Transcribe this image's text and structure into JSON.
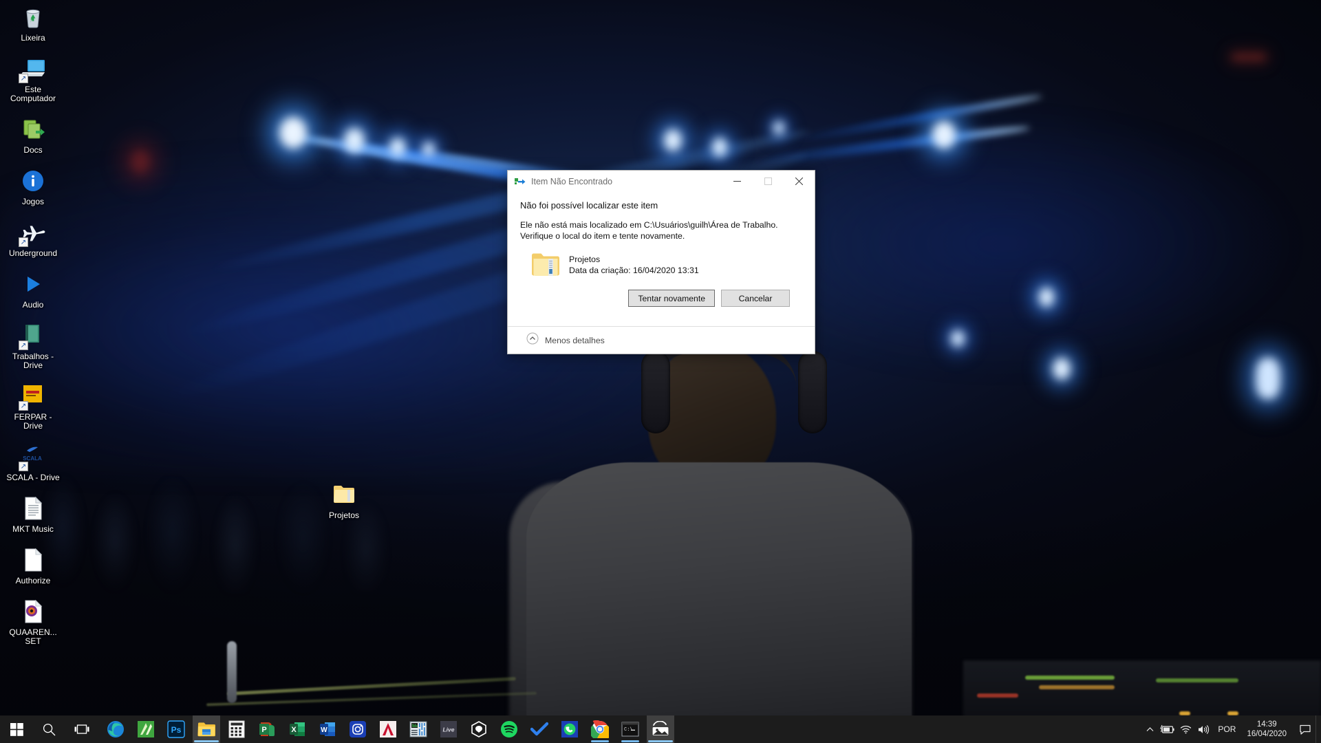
{
  "wallpaper": {
    "description": "dj-performing-at-concert-with-blue-laser-beams",
    "dominant_colors": [
      "#0a0f22",
      "#1a6fe0",
      "#2f9bff",
      "#3a3027"
    ]
  },
  "desktop": {
    "icons": [
      {
        "label": "Lixeira",
        "icon": "recycle-bin-icon",
        "shortcut": false
      },
      {
        "label": "Este Computador",
        "icon": "this-pc-icon",
        "shortcut": true
      },
      {
        "label": "Docs",
        "icon": "documents-folder-icon",
        "shortcut": false
      },
      {
        "label": "Jogos",
        "icon": "info-circle-icon",
        "shortcut": false
      },
      {
        "label": "Underground",
        "icon": "airplane-icon",
        "shortcut": true
      },
      {
        "label": "Audio",
        "icon": "play-triangle-icon",
        "shortcut": false
      },
      {
        "label": "Trabalhos - Drive",
        "icon": "green-book-icon",
        "shortcut": true
      },
      {
        "label": "FERPAR - Drive",
        "icon": "ferpar-yellow-icon",
        "shortcut": true
      },
      {
        "label": "SCALA - Drive",
        "icon": "scala-logo-icon",
        "shortcut": true
      },
      {
        "label": "MKT Music",
        "icon": "text-document-icon",
        "shortcut": false
      },
      {
        "label": "Authorize",
        "icon": "blank-document-icon",
        "shortcut": false
      },
      {
        "label": "QUAAREN... SET",
        "icon": "media-disc-document-icon",
        "shortcut": false
      }
    ],
    "free_item": {
      "label": "Projetos",
      "icon": "folder-icon"
    }
  },
  "dialog": {
    "title": "Item Não Encontrado",
    "title_icon": "move-item-icon",
    "window_controls": {
      "minimize": "minimize-icon",
      "maximize": "maximize-icon",
      "close": "close-icon"
    },
    "main_message": "Não foi possível localizar este item",
    "sub_message_line1": "Ele não está mais localizado em C:\\Usuários\\guilh\\Área de Trabalho.",
    "sub_message_line2": "Verifique o local do item e tente novamente.",
    "item": {
      "icon": "folder-icon",
      "name": "Projetos",
      "date_label": "Data da criação: 16/04/2020 13:31"
    },
    "buttons": {
      "retry": "Tentar novamente",
      "cancel": "Cancelar"
    },
    "details_toggle": {
      "label": "Menos detalhes",
      "icon": "chevron-up-circle-icon"
    }
  },
  "taskbar": {
    "start": "start-button",
    "search": "search-icon",
    "task_view": "task-view-icon",
    "apps": [
      {
        "name": "Microsoft Edge",
        "icon": "edge-icon",
        "running": false,
        "active": false
      },
      {
        "name": "Sublime Text",
        "icon": "sublime-text-icon",
        "running": false,
        "active": false
      },
      {
        "name": "Adobe Photoshop",
        "icon": "photoshop-icon",
        "running": false,
        "active": false
      },
      {
        "name": "Explorador de Arquivos",
        "icon": "file-explorer-icon",
        "running": true,
        "active": true
      },
      {
        "name": "Calculadora",
        "icon": "calculator-icon",
        "running": false,
        "active": false
      },
      {
        "name": "PowerPoint",
        "icon": "powerpoint-icon",
        "running": false,
        "active": false
      },
      {
        "name": "Excel",
        "icon": "excel-icon",
        "running": false,
        "active": false
      },
      {
        "name": "Word",
        "icon": "word-icon",
        "running": false,
        "active": false
      },
      {
        "name": "Instagram",
        "icon": "instagram-icon",
        "running": false,
        "active": false
      },
      {
        "name": "AutoCAD",
        "icon": "autocad-icon",
        "running": false,
        "active": false
      },
      {
        "name": "Mixer de Áudio",
        "icon": "audio-mixer-icon",
        "running": false,
        "active": false
      },
      {
        "name": "Ableton Live",
        "icon": "ableton-live-icon",
        "running": false,
        "active": false
      },
      {
        "name": "SketchUp",
        "icon": "sketchup-icon",
        "running": false,
        "active": false
      },
      {
        "name": "Spotify",
        "icon": "spotify-icon",
        "running": false,
        "active": false
      },
      {
        "name": "Todoist",
        "icon": "checkmark-icon",
        "running": false,
        "active": false
      },
      {
        "name": "WhatsApp",
        "icon": "whatsapp-icon",
        "running": false,
        "active": false
      },
      {
        "name": "Google Chrome",
        "icon": "chrome-icon",
        "running": true,
        "active": false
      },
      {
        "name": "Prompt de Comando",
        "icon": "command-prompt-icon",
        "running": true,
        "active": false
      },
      {
        "name": "Fotos",
        "icon": "photos-icon",
        "running": true,
        "active": true
      }
    ],
    "tray": {
      "overflow": "chevron-up-icon",
      "battery": "battery-charging-icon",
      "network": "wifi-icon",
      "volume": "speaker-icon",
      "language": "POR",
      "time": "14:39",
      "date": "16/04/2020",
      "action_center": "notification-icon"
    }
  }
}
